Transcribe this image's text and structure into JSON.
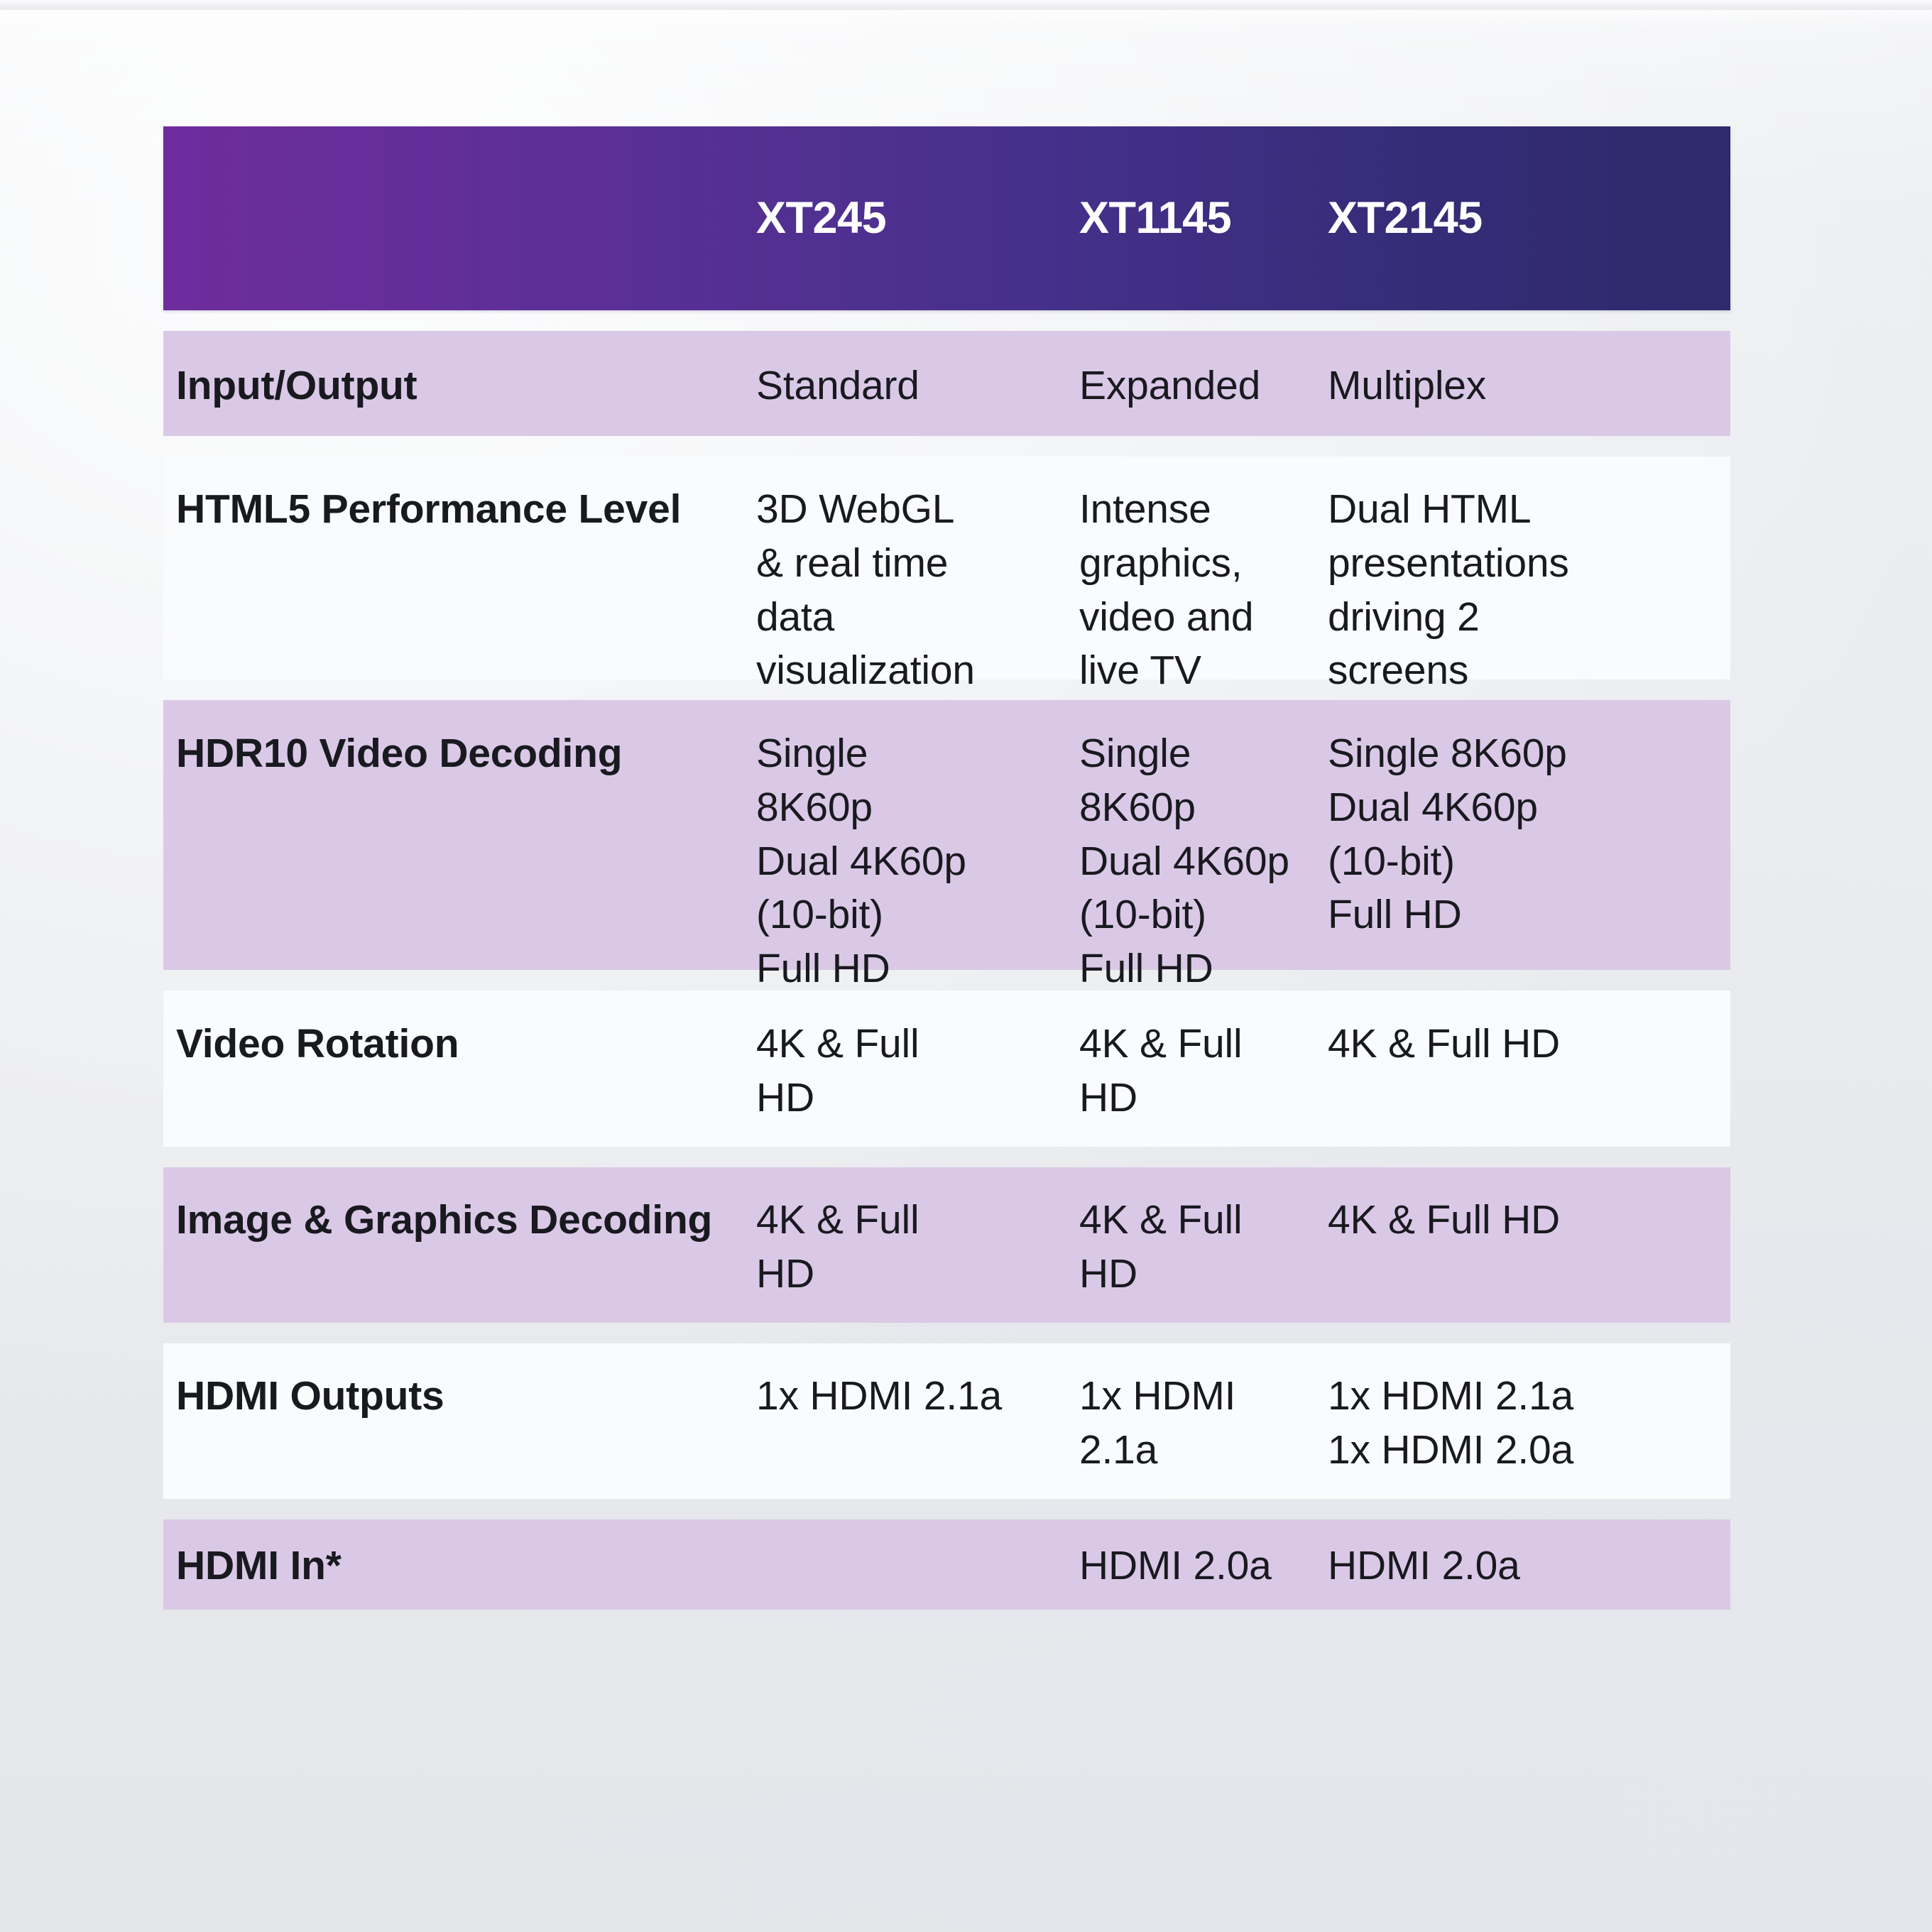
{
  "theme": {
    "header_gradient_start": "#6e2d9c",
    "header_gradient_end": "#2e2a6b",
    "row_alt_background": "#dac9e6",
    "row_plain_background": "#fafbfd",
    "text_color": "#191a20",
    "header_text_color": "#ffffff",
    "page_background": "#e9ebee"
  },
  "table": {
    "columns": [
      {
        "key": "feature",
        "label": ""
      },
      {
        "key": "xt245",
        "label": "XT245"
      },
      {
        "key": "xt1145",
        "label": "XT1145"
      },
      {
        "key": "xt2145",
        "label": "XT2145"
      }
    ],
    "rows": [
      {
        "feature": "Input/Output",
        "xt245": "Standard",
        "xt1145": "Expanded",
        "xt2145": "Multiplex"
      },
      {
        "feature": "HTML5 Performance Level",
        "xt245": "3D WebGL\n& real time\ndata\nvisualization",
        "xt1145": "Intense\ngraphics,\nvideo and\nlive TV",
        "xt2145": "Dual HTML\npresentations\ndriving 2\nscreens"
      },
      {
        "feature": "HDR10 Video Decoding",
        "xt245": "Single\n8K60p\nDual 4K60p\n(10-bit)\nFull HD",
        "xt1145": "Single\n8K60p\nDual 4K60p\n(10-bit)\nFull HD",
        "xt2145": "Single 8K60p\nDual 4K60p\n(10-bit)\nFull HD"
      },
      {
        "feature": "Video Rotation",
        "xt245": "4K & Full\nHD",
        "xt1145": "4K & Full\nHD",
        "xt2145": "4K & Full HD"
      },
      {
        "feature": "Image & Graphics Decoding",
        "xt245": "4K & Full\nHD",
        "xt1145": "4K & Full\nHD",
        "xt2145": "4K & Full HD"
      },
      {
        "feature": "HDMI Outputs",
        "xt245": "1x HDMI 2.1a",
        "xt1145": "1x HDMI\n2.1a",
        "xt2145": "1x HDMI 2.1a\n1x HDMI 2.0a"
      },
      {
        "feature": "HDMI In*",
        "xt245": "",
        "xt1145": "HDMI 2.0a",
        "xt2145": "HDMI 2.0a"
      }
    ]
  }
}
